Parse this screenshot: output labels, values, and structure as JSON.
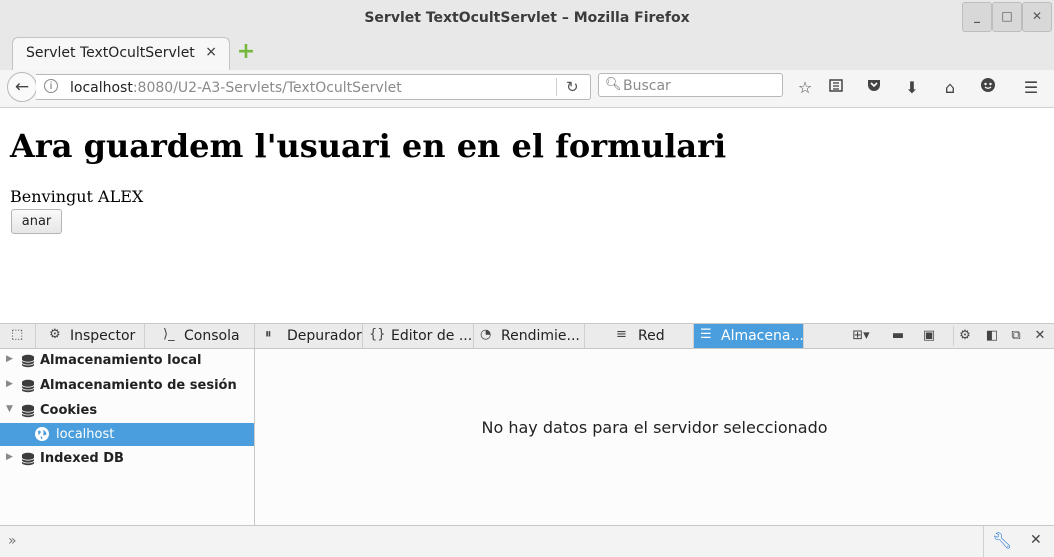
{
  "window": {
    "title": "Servlet TextOcultServlet – Mozilla Firefox"
  },
  "tab": {
    "label": "Servlet TextOcultServlet",
    "close": "×"
  },
  "nav": {
    "url_host": "localhost",
    "url_path": ":8080/U2-A3-Servlets/TextOcultServlet",
    "search_placeholder": "Buscar"
  },
  "page": {
    "heading": "Ara guardem l'usuari en en el formulari",
    "welcome": "Benvingut ALEX",
    "button_label": "anar"
  },
  "devtools": {
    "tabs": [
      {
        "label": "Inspector",
        "icon": "inspector-icon"
      },
      {
        "label": "Consola",
        "icon": "console-icon"
      },
      {
        "label": "Depurador",
        "icon": "debugger-icon"
      },
      {
        "label": "Editor de ...",
        "icon": "style-editor-icon"
      },
      {
        "label": "Rendimie...",
        "icon": "performance-icon"
      },
      {
        "label": "Red",
        "icon": "network-icon"
      },
      {
        "label": "Almacena...",
        "icon": "storage-icon"
      }
    ],
    "storage_tree": [
      {
        "label": "Almacenamiento local"
      },
      {
        "label": "Almacenamiento de sesión"
      },
      {
        "label": "Cookies"
      },
      {
        "label": "localhost"
      },
      {
        "label": "Indexed DB"
      }
    ],
    "empty_message": "No hay datos para el servidor seleccionado"
  },
  "colors": {
    "accent": "#4a9edd",
    "new_tab": "#74b83b"
  }
}
